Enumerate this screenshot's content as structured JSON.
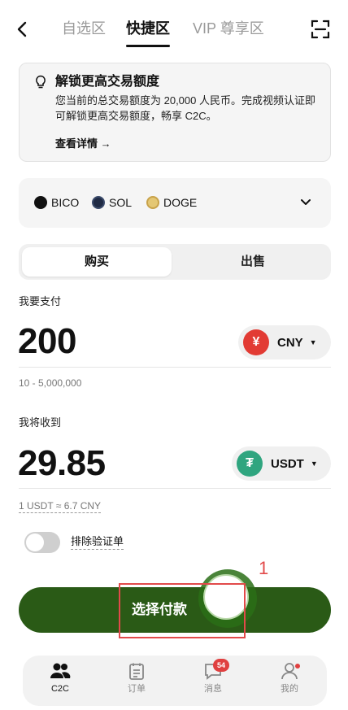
{
  "nav": {
    "tabs": [
      {
        "label": "自选区",
        "active": false
      },
      {
        "label": "快捷区",
        "active": true
      },
      {
        "label": "VIP 尊享区",
        "active": false
      }
    ],
    "icons": {
      "back": "back-arrow-icon",
      "scan": "scan-icon"
    }
  },
  "info_card": {
    "title": "解锁更高交易额度",
    "body": "您当前的总交易额度为 20,000 人民币。完成视频认证即可解锁更高交易额度，畅享 C2C。",
    "link": "查看详情 →"
  },
  "coins": {
    "items": [
      {
        "label": "BICO",
        "color": "#111111"
      },
      {
        "label": "SOL",
        "color": "#1f2a44"
      },
      {
        "label": "DOGE",
        "color": "#c8a24a"
      }
    ]
  },
  "segment": {
    "buy": "购买",
    "sell": "出售",
    "active": "购买"
  },
  "pay": {
    "label": "我要支付",
    "amount": "200",
    "currency": "CNY",
    "currency_symbol": "¥",
    "currency_color": "#e23b34",
    "range": "10 - 5,000,000"
  },
  "receive": {
    "label": "我将收到",
    "amount": "29.85",
    "currency": "USDT",
    "currency_symbol": "₮",
    "currency_color": "#2fa57f",
    "rate": "1 USDT ≈ 6.7 CNY"
  },
  "toggle": {
    "label": "排除验证单",
    "on": false
  },
  "cta": {
    "label": "选择付款",
    "color": "#2a5a16"
  },
  "annotation": {
    "step": "1",
    "color": "#e24a4a"
  },
  "bottom_nav": {
    "items": [
      {
        "label": "C2C",
        "icon": "users-icon",
        "active": true
      },
      {
        "label": "订单",
        "icon": "clipboard-icon",
        "active": false
      },
      {
        "label": "消息",
        "icon": "chat-icon",
        "active": false,
        "badge": "54"
      },
      {
        "label": "我的",
        "icon": "profile-icon",
        "active": false
      }
    ]
  }
}
